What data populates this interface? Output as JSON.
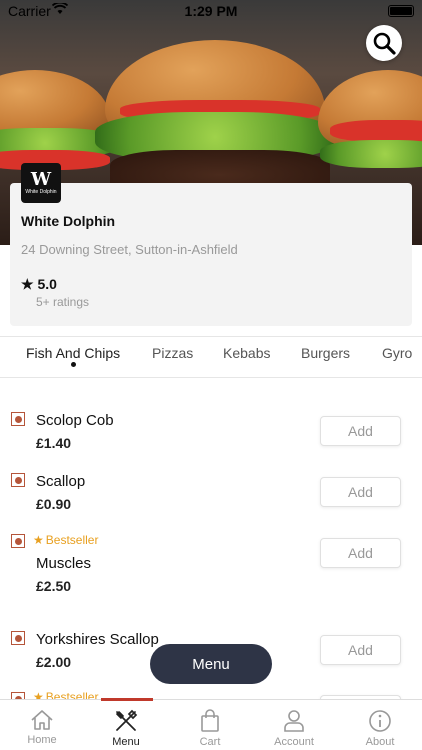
{
  "status_bar": {
    "carrier": "Carrier",
    "time": "1:29 PM"
  },
  "restaurant": {
    "logo_text": "White Dolphin",
    "name": "White Dolphin",
    "address": "24 Downing Street, Sutton-in-Ashfield",
    "rating": "5.0",
    "ratings_count": "5+ ratings"
  },
  "categories": [
    "Fish And Chips",
    "Pizzas",
    "Kebabs",
    "Burgers",
    "Gyro"
  ],
  "items": [
    {
      "name": "Scolop Cob",
      "price": "£1.40",
      "add": "Add"
    },
    {
      "name": "Scallop",
      "price": "£0.90",
      "add": "Add"
    },
    {
      "badge": "Bestseller",
      "name": "Muscles",
      "price": "£2.50",
      "add": "Add"
    },
    {
      "name": "Yorkshires Scallop",
      "price": "£2.00",
      "add": "Add"
    },
    {
      "badge": "Bestseller"
    }
  ],
  "floating_menu": "Menu",
  "tabbar": [
    {
      "label": "Home",
      "icon": "home-icon"
    },
    {
      "label": "Menu",
      "icon": "fork-knife-icon"
    },
    {
      "label": "Cart",
      "icon": "bag-icon"
    },
    {
      "label": "Account",
      "icon": "user-icon"
    },
    {
      "label": "About",
      "icon": "info-icon"
    }
  ],
  "colors": {
    "accent": "#c0392b",
    "veg": "#b5553a",
    "bestseller": "#e8a020",
    "menu_button": "#2e3446"
  }
}
